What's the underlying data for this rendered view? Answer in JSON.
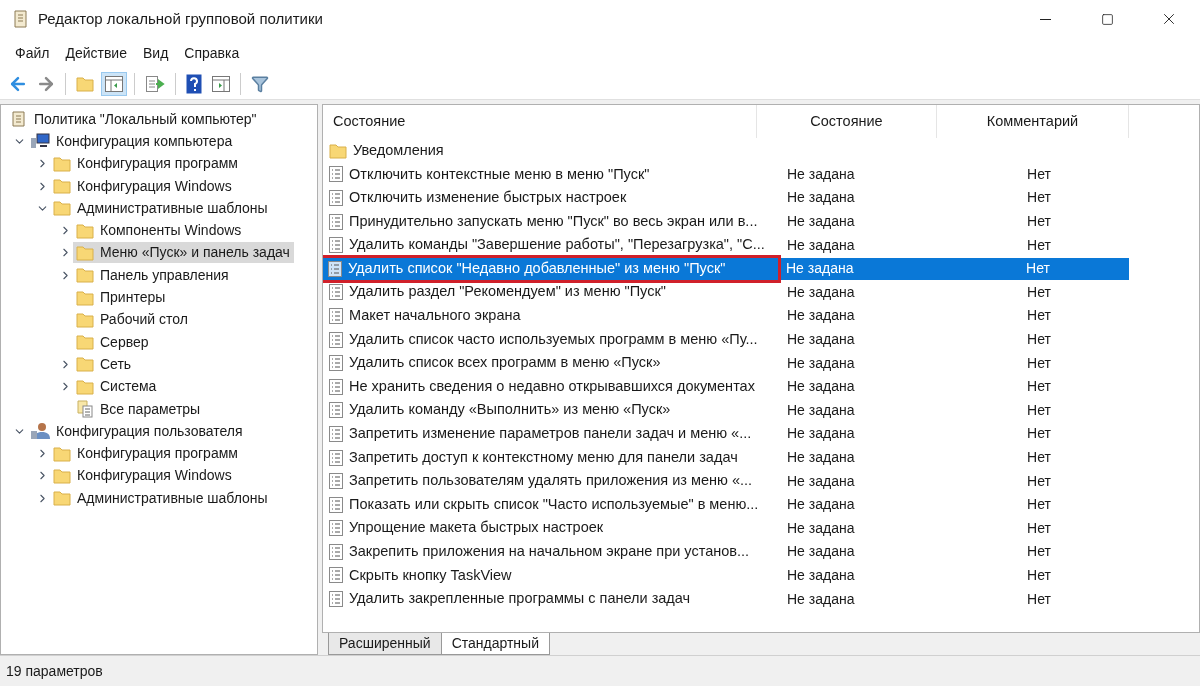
{
  "window": {
    "title": "Редактор локальной групповой политики"
  },
  "menu": [
    "Файл",
    "Действие",
    "Вид",
    "Справка"
  ],
  "tree": [
    {
      "label": "Политика \"Локальный компьютер\"",
      "kind": "root",
      "selected": false,
      "children": [
        {
          "label": "Конфигурация компьютера",
          "kind": "computer",
          "expanded": true,
          "selected": false,
          "children": [
            {
              "label": "Конфигурация программ",
              "kind": "folder",
              "expanded": false,
              "selected": false
            },
            {
              "label": "Конфигурация Windows",
              "kind": "folder",
              "expanded": false,
              "selected": false
            },
            {
              "label": "Административные шаблоны",
              "kind": "folder",
              "expanded": true,
              "selected": false,
              "children": [
                {
                  "label": "Компоненты Windows",
                  "kind": "folder",
                  "expanded": false,
                  "selected": false
                },
                {
                  "label": "Меню «Пуск» и панель задач",
                  "kind": "folder",
                  "expanded": false,
                  "selected": true
                },
                {
                  "label": "Панель управления",
                  "kind": "folder",
                  "expanded": false,
                  "selected": false
                },
                {
                  "label": "Принтеры",
                  "kind": "folder",
                  "selected": false
                },
                {
                  "label": "Рабочий стол",
                  "kind": "folder",
                  "selected": false
                },
                {
                  "label": "Сервер",
                  "kind": "folder",
                  "selected": false
                },
                {
                  "label": "Сеть",
                  "kind": "folder",
                  "expanded": false,
                  "selected": false
                },
                {
                  "label": "Система",
                  "kind": "folder",
                  "expanded": false,
                  "selected": false
                },
                {
                  "label": "Все параметры",
                  "kind": "settings",
                  "selected": false
                }
              ]
            }
          ]
        },
        {
          "label": "Конфигурация пользователя",
          "kind": "user",
          "expanded": true,
          "selected": false,
          "children": [
            {
              "label": "Конфигурация программ",
              "kind": "folder",
              "expanded": false,
              "selected": false
            },
            {
              "label": "Конфигурация Windows",
              "kind": "folder",
              "expanded": false,
              "selected": false
            },
            {
              "label": "Административные шаблоны",
              "kind": "folder",
              "expanded": false,
              "selected": false
            }
          ]
        }
      ]
    }
  ],
  "table": {
    "columns": [
      "Состояние",
      "Состояние",
      "Комментарий"
    ],
    "rows": [
      {
        "name": "Уведомления",
        "kind": "folder",
        "selected": false,
        "highlighted": false
      },
      {
        "name": "Отключить контекстные меню в меню \"Пуск\"",
        "state": "Не задана",
        "comment": "Нет",
        "kind": "policy",
        "selected": false,
        "highlighted": false
      },
      {
        "name": "Отключить изменение быстрых настроек",
        "state": "Не задана",
        "comment": "Нет",
        "kind": "policy",
        "selected": false,
        "highlighted": false
      },
      {
        "name": "Принудительно запускать меню \"Пуск\" во весь экран или в...",
        "state": "Не задана",
        "comment": "Нет",
        "kind": "policy",
        "selected": false,
        "highlighted": false
      },
      {
        "name": "Удалить команды \"Завершение работы\", \"Перезагрузка\", \"С...",
        "state": "Не задана",
        "comment": "Нет",
        "kind": "policy",
        "selected": false,
        "highlighted": false
      },
      {
        "name": "Удалить список \"Недавно добавленные\" из меню \"Пуск\"",
        "state": "Не задана",
        "comment": "Нет",
        "kind": "policy",
        "selected": true,
        "highlighted": true
      },
      {
        "name": "Удалить раздел \"Рекомендуем\" из меню \"Пуск\"",
        "state": "Не задана",
        "comment": "Нет",
        "kind": "policy",
        "selected": false,
        "highlighted": false
      },
      {
        "name": "Макет начального экрана",
        "state": "Не задана",
        "comment": "Нет",
        "kind": "policy",
        "selected": false,
        "highlighted": false
      },
      {
        "name": "Удалить список часто используемых программ в меню «Пу...",
        "state": "Не задана",
        "comment": "Нет",
        "kind": "policy",
        "selected": false,
        "highlighted": false
      },
      {
        "name": "Удалить список всех программ в меню «Пуск»",
        "state": "Не задана",
        "comment": "Нет",
        "kind": "policy",
        "selected": false,
        "highlighted": false
      },
      {
        "name": "Не хранить сведения о недавно открывавшихся документах",
        "state": "Не задана",
        "comment": "Нет",
        "kind": "policy",
        "selected": false,
        "highlighted": false
      },
      {
        "name": "Удалить команду «Выполнить» из меню «Пуск»",
        "state": "Не задана",
        "comment": "Нет",
        "kind": "policy",
        "selected": false,
        "highlighted": false
      },
      {
        "name": "Запретить изменение параметров панели задач и меню «...",
        "state": "Не задана",
        "comment": "Нет",
        "kind": "policy",
        "selected": false,
        "highlighted": false
      },
      {
        "name": "Запретить доступ к контекстному меню для панели задач",
        "state": "Не задана",
        "comment": "Нет",
        "kind": "policy",
        "selected": false,
        "highlighted": false
      },
      {
        "name": "Запретить пользователям удалять приложения из меню «...",
        "state": "Не задана",
        "comment": "Нет",
        "kind": "policy",
        "selected": false,
        "highlighted": false
      },
      {
        "name": "Показать или скрыть список \"Часто используемые\" в меню...",
        "state": "Не задана",
        "comment": "Нет",
        "kind": "policy",
        "selected": false,
        "highlighted": false
      },
      {
        "name": "Упрощение макета быстрых настроек",
        "state": "Не задана",
        "comment": "Нет",
        "kind": "policy",
        "selected": false,
        "highlighted": false
      },
      {
        "name": "Закрепить приложения на начальном экране при установ...",
        "state": "Не задана",
        "comment": "Нет",
        "kind": "policy",
        "selected": false,
        "highlighted": false
      },
      {
        "name": "Скрыть кнопку TaskView",
        "state": "Не задана",
        "comment": "Нет",
        "kind": "policy",
        "selected": false,
        "highlighted": false
      },
      {
        "name": "Удалить закрепленные программы с панели задач",
        "state": "Не задана",
        "comment": "Нет",
        "kind": "policy",
        "selected": false,
        "highlighted": false
      }
    ]
  },
  "view_tabs": [
    {
      "label": "Расширенный",
      "selected": false
    },
    {
      "label": "Стандартный",
      "selected": true
    }
  ],
  "status_bar": "19 параметров"
}
